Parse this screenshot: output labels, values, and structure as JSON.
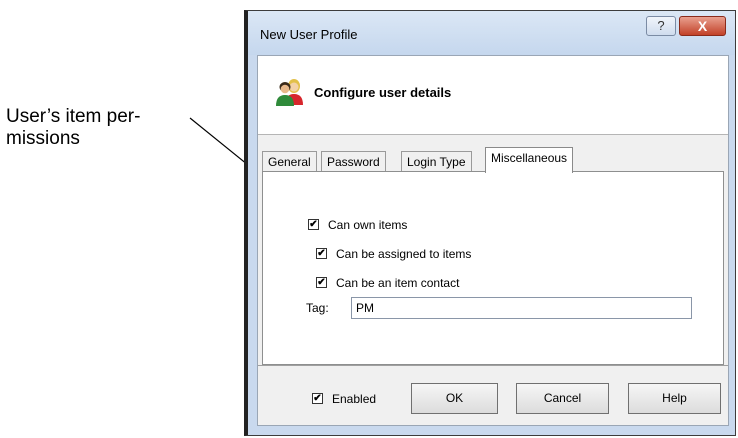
{
  "callout": {
    "line1": "User’s item per-",
    "line2": "missions"
  },
  "window": {
    "title": "New User Profile",
    "help_glyph": "?",
    "close_glyph": "X",
    "header_title": "Configure user details"
  },
  "tabs": [
    {
      "label": "General",
      "active": false
    },
    {
      "label": "Password",
      "active": false
    },
    {
      "label": "Login Type",
      "active": false
    },
    {
      "label": "Miscellaneous",
      "active": true
    }
  ],
  "permissions": [
    {
      "label": "Can own items",
      "checked": true
    },
    {
      "label": "Can be assigned to items",
      "checked": true
    },
    {
      "label": "Can be an item contact",
      "checked": true
    }
  ],
  "tag": {
    "label": "Tag:",
    "value": "PM"
  },
  "footer": {
    "enabled_label": "Enabled",
    "enabled_checked": true,
    "ok_label": "OK",
    "cancel_label": "Cancel",
    "help_label": "Help"
  },
  "colors": {
    "titlebar": "#c5d7ee",
    "close_button": "#c24128",
    "dialog_bg": "#f0f0f0"
  },
  "icons": {
    "header": "users-icon",
    "close": "close-icon",
    "help": "help-icon"
  }
}
